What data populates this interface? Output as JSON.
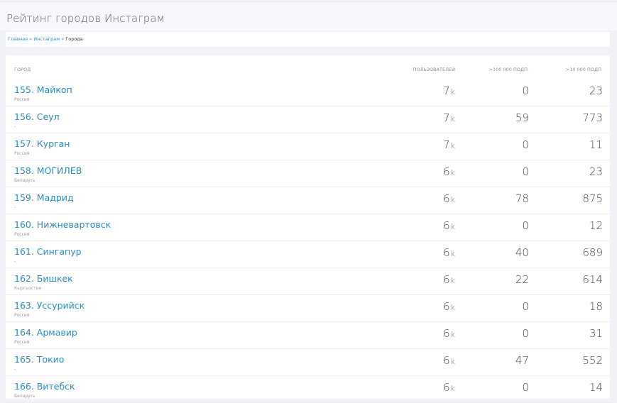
{
  "page": {
    "title": "Рейтинг городов Инстаграм"
  },
  "breadcrumb": {
    "items": [
      "Главная",
      "Инстаграм"
    ],
    "separator": "»",
    "current": "Города"
  },
  "table": {
    "headers": {
      "city": "ГОРОД",
      "users": "ПОЛЬЗОВАТЕЛЕЙ",
      "over100k": ">100 000 ПОДП.",
      "over10k": ">10 000 ПОДП."
    },
    "rows": [
      {
        "city": "155. Майкоп",
        "country": "Россия",
        "users": "7",
        "unit": "k",
        "over100k": "0",
        "over10k": "23"
      },
      {
        "city": "156. Сеул",
        "country": "-",
        "users": "7",
        "unit": "k",
        "over100k": "59",
        "over10k": "773"
      },
      {
        "city": "157. Курган",
        "country": "Россия",
        "users": "7",
        "unit": "k",
        "over100k": "0",
        "over10k": "11"
      },
      {
        "city": "158. МОГИЛЕВ",
        "country": "Беларусь",
        "users": "6",
        "unit": "k",
        "over100k": "0",
        "over10k": "23"
      },
      {
        "city": "159. Мадрид",
        "country": "-",
        "users": "6",
        "unit": "k",
        "over100k": "78",
        "over10k": "875"
      },
      {
        "city": "160. Нижневартовск",
        "country": "Россия",
        "users": "6",
        "unit": "k",
        "over100k": "0",
        "over10k": "12"
      },
      {
        "city": "161. Сингапур",
        "country": "-",
        "users": "6",
        "unit": "k",
        "over100k": "40",
        "over10k": "689"
      },
      {
        "city": "162. Бишкек",
        "country": "Кыргызстан",
        "users": "6",
        "unit": "k",
        "over100k": "22",
        "over10k": "614"
      },
      {
        "city": "163. Уссурийск",
        "country": "Россия",
        "users": "6",
        "unit": "k",
        "over100k": "0",
        "over10k": "18"
      },
      {
        "city": "164. Армавир",
        "country": "Россия",
        "users": "6",
        "unit": "k",
        "over100k": "0",
        "over10k": "31"
      },
      {
        "city": "165. Токио",
        "country": "-",
        "users": "6",
        "unit": "k",
        "over100k": "47",
        "over10k": "552"
      },
      {
        "city": "166. Витебск",
        "country": "Беларусь",
        "users": "6",
        "unit": "k",
        "over100k": "0",
        "over10k": "14"
      }
    ]
  }
}
